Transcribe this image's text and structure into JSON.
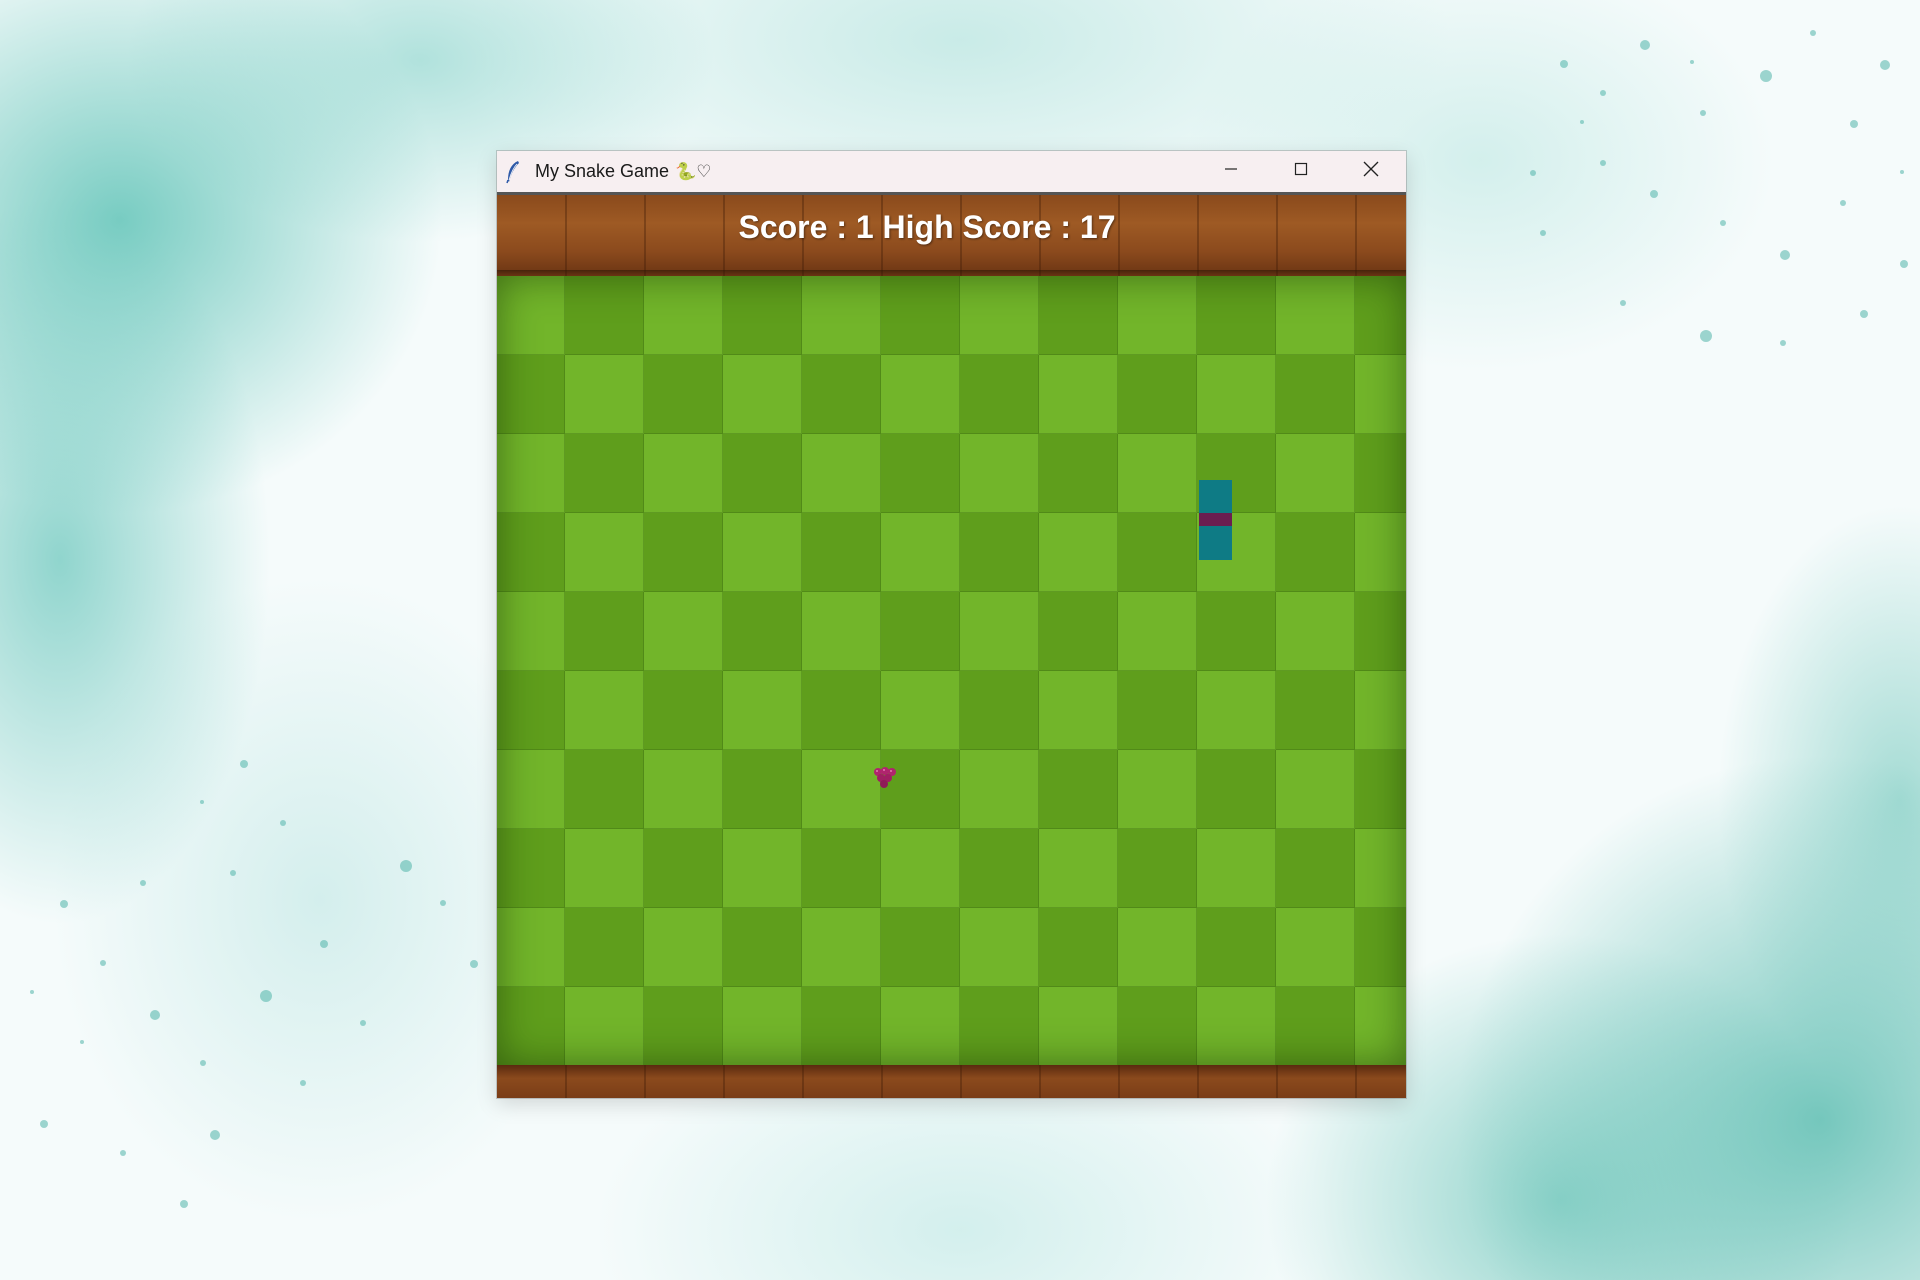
{
  "window": {
    "title": "My Snake Game",
    "title_emoji": "🐍♡",
    "controls": [
      "minimize-icon",
      "maximize-icon",
      "close-icon"
    ]
  },
  "hud": {
    "score_label": "Score : 1 High Score : 17",
    "score": 1,
    "high_score": 17
  },
  "board": {
    "columns": 12,
    "rows": 10,
    "tile_color_light": "#72b52a",
    "tile_color_dark": "#5f9e1c",
    "wood_color": "#8a4a1c"
  },
  "snake": {
    "segment_color": "#0e7b85",
    "accent_color": "#6b1e50",
    "direction": "vertical"
  },
  "food": {
    "type": "grapes-icon",
    "color": "#b0246e"
  },
  "background": {
    "style": "watercolor",
    "accent": "#5fbfb2"
  }
}
